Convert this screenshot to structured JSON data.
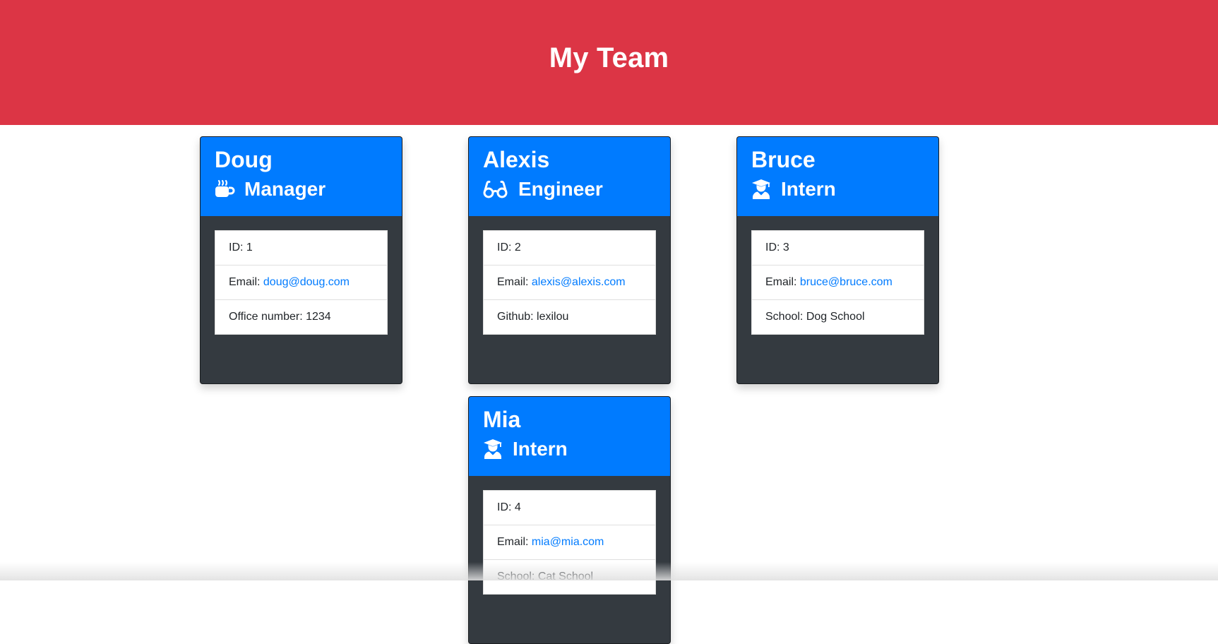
{
  "header": {
    "title": "My Team"
  },
  "team": [
    {
      "name": "Doug",
      "role": "Manager",
      "icon": "coffee-icon",
      "id_text": "ID: 1",
      "email_label": "Email: ",
      "email": "doug@doug.com",
      "extra_text": "Office number: 1234"
    },
    {
      "name": "Alexis",
      "role": "Engineer",
      "icon": "glasses-icon",
      "id_text": "ID: 2",
      "email_label": "Email: ",
      "email": "alexis@alexis.com",
      "extra_text": "Github: lexilou"
    },
    {
      "name": "Bruce",
      "role": "Intern",
      "icon": "user-graduate-icon",
      "id_text": "ID: 3",
      "email_label": "Email: ",
      "email": "bruce@bruce.com",
      "extra_text": "School: Dog School"
    },
    {
      "name": "Mia",
      "role": "Intern",
      "icon": "user-graduate-icon",
      "id_text": "ID: 4",
      "email_label": "Email: ",
      "email": "mia@mia.com",
      "extra_text": "School: Cat School"
    }
  ],
  "colors": {
    "header_bg": "#dc3545",
    "card_header_bg": "#007bff",
    "card_body_bg": "#343a40",
    "link": "#007bff"
  }
}
